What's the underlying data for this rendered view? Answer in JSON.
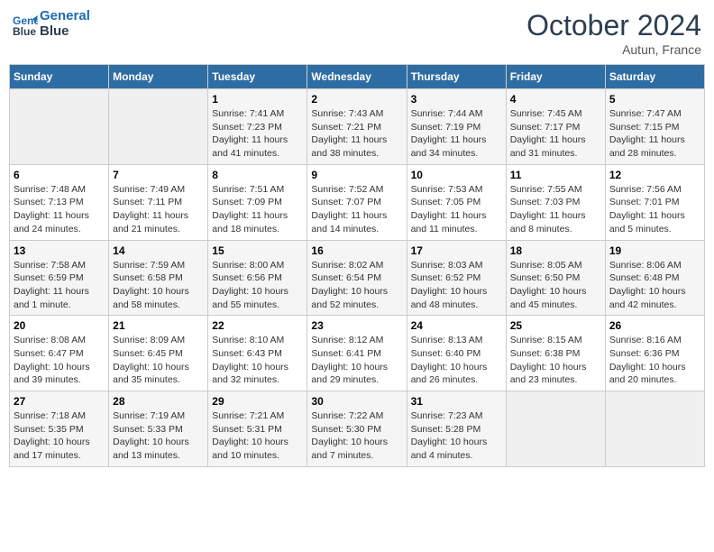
{
  "header": {
    "logo_line1": "General",
    "logo_line2": "Blue",
    "month": "October 2024",
    "location": "Autun, France"
  },
  "days_of_week": [
    "Sunday",
    "Monday",
    "Tuesday",
    "Wednesday",
    "Thursday",
    "Friday",
    "Saturday"
  ],
  "weeks": [
    [
      {
        "day": "",
        "sunrise": "",
        "sunset": "",
        "daylight": "",
        "empty": true
      },
      {
        "day": "",
        "sunrise": "",
        "sunset": "",
        "daylight": "",
        "empty": true
      },
      {
        "day": "1",
        "sunrise": "Sunrise: 7:41 AM",
        "sunset": "Sunset: 7:23 PM",
        "daylight": "Daylight: 11 hours and 41 minutes."
      },
      {
        "day": "2",
        "sunrise": "Sunrise: 7:43 AM",
        "sunset": "Sunset: 7:21 PM",
        "daylight": "Daylight: 11 hours and 38 minutes."
      },
      {
        "day": "3",
        "sunrise": "Sunrise: 7:44 AM",
        "sunset": "Sunset: 7:19 PM",
        "daylight": "Daylight: 11 hours and 34 minutes."
      },
      {
        "day": "4",
        "sunrise": "Sunrise: 7:45 AM",
        "sunset": "Sunset: 7:17 PM",
        "daylight": "Daylight: 11 hours and 31 minutes."
      },
      {
        "day": "5",
        "sunrise": "Sunrise: 7:47 AM",
        "sunset": "Sunset: 7:15 PM",
        "daylight": "Daylight: 11 hours and 28 minutes."
      }
    ],
    [
      {
        "day": "6",
        "sunrise": "Sunrise: 7:48 AM",
        "sunset": "Sunset: 7:13 PM",
        "daylight": "Daylight: 11 hours and 24 minutes."
      },
      {
        "day": "7",
        "sunrise": "Sunrise: 7:49 AM",
        "sunset": "Sunset: 7:11 PM",
        "daylight": "Daylight: 11 hours and 21 minutes."
      },
      {
        "day": "8",
        "sunrise": "Sunrise: 7:51 AM",
        "sunset": "Sunset: 7:09 PM",
        "daylight": "Daylight: 11 hours and 18 minutes."
      },
      {
        "day": "9",
        "sunrise": "Sunrise: 7:52 AM",
        "sunset": "Sunset: 7:07 PM",
        "daylight": "Daylight: 11 hours and 14 minutes."
      },
      {
        "day": "10",
        "sunrise": "Sunrise: 7:53 AM",
        "sunset": "Sunset: 7:05 PM",
        "daylight": "Daylight: 11 hours and 11 minutes."
      },
      {
        "day": "11",
        "sunrise": "Sunrise: 7:55 AM",
        "sunset": "Sunset: 7:03 PM",
        "daylight": "Daylight: 11 hours and 8 minutes."
      },
      {
        "day": "12",
        "sunrise": "Sunrise: 7:56 AM",
        "sunset": "Sunset: 7:01 PM",
        "daylight": "Daylight: 11 hours and 5 minutes."
      }
    ],
    [
      {
        "day": "13",
        "sunrise": "Sunrise: 7:58 AM",
        "sunset": "Sunset: 6:59 PM",
        "daylight": "Daylight: 11 hours and 1 minute."
      },
      {
        "day": "14",
        "sunrise": "Sunrise: 7:59 AM",
        "sunset": "Sunset: 6:58 PM",
        "daylight": "Daylight: 10 hours and 58 minutes."
      },
      {
        "day": "15",
        "sunrise": "Sunrise: 8:00 AM",
        "sunset": "Sunset: 6:56 PM",
        "daylight": "Daylight: 10 hours and 55 minutes."
      },
      {
        "day": "16",
        "sunrise": "Sunrise: 8:02 AM",
        "sunset": "Sunset: 6:54 PM",
        "daylight": "Daylight: 10 hours and 52 minutes."
      },
      {
        "day": "17",
        "sunrise": "Sunrise: 8:03 AM",
        "sunset": "Sunset: 6:52 PM",
        "daylight": "Daylight: 10 hours and 48 minutes."
      },
      {
        "day": "18",
        "sunrise": "Sunrise: 8:05 AM",
        "sunset": "Sunset: 6:50 PM",
        "daylight": "Daylight: 10 hours and 45 minutes."
      },
      {
        "day": "19",
        "sunrise": "Sunrise: 8:06 AM",
        "sunset": "Sunset: 6:48 PM",
        "daylight": "Daylight: 10 hours and 42 minutes."
      }
    ],
    [
      {
        "day": "20",
        "sunrise": "Sunrise: 8:08 AM",
        "sunset": "Sunset: 6:47 PM",
        "daylight": "Daylight: 10 hours and 39 minutes."
      },
      {
        "day": "21",
        "sunrise": "Sunrise: 8:09 AM",
        "sunset": "Sunset: 6:45 PM",
        "daylight": "Daylight: 10 hours and 35 minutes."
      },
      {
        "day": "22",
        "sunrise": "Sunrise: 8:10 AM",
        "sunset": "Sunset: 6:43 PM",
        "daylight": "Daylight: 10 hours and 32 minutes."
      },
      {
        "day": "23",
        "sunrise": "Sunrise: 8:12 AM",
        "sunset": "Sunset: 6:41 PM",
        "daylight": "Daylight: 10 hours and 29 minutes."
      },
      {
        "day": "24",
        "sunrise": "Sunrise: 8:13 AM",
        "sunset": "Sunset: 6:40 PM",
        "daylight": "Daylight: 10 hours and 26 minutes."
      },
      {
        "day": "25",
        "sunrise": "Sunrise: 8:15 AM",
        "sunset": "Sunset: 6:38 PM",
        "daylight": "Daylight: 10 hours and 23 minutes."
      },
      {
        "day": "26",
        "sunrise": "Sunrise: 8:16 AM",
        "sunset": "Sunset: 6:36 PM",
        "daylight": "Daylight: 10 hours and 20 minutes."
      }
    ],
    [
      {
        "day": "27",
        "sunrise": "Sunrise: 7:18 AM",
        "sunset": "Sunset: 5:35 PM",
        "daylight": "Daylight: 10 hours and 17 minutes."
      },
      {
        "day": "28",
        "sunrise": "Sunrise: 7:19 AM",
        "sunset": "Sunset: 5:33 PM",
        "daylight": "Daylight: 10 hours and 13 minutes."
      },
      {
        "day": "29",
        "sunrise": "Sunrise: 7:21 AM",
        "sunset": "Sunset: 5:31 PM",
        "daylight": "Daylight: 10 hours and 10 minutes."
      },
      {
        "day": "30",
        "sunrise": "Sunrise: 7:22 AM",
        "sunset": "Sunset: 5:30 PM",
        "daylight": "Daylight: 10 hours and 7 minutes."
      },
      {
        "day": "31",
        "sunrise": "Sunrise: 7:23 AM",
        "sunset": "Sunset: 5:28 PM",
        "daylight": "Daylight: 10 hours and 4 minutes."
      },
      {
        "day": "",
        "sunrise": "",
        "sunset": "",
        "daylight": "",
        "empty": true
      },
      {
        "day": "",
        "sunrise": "",
        "sunset": "",
        "daylight": "",
        "empty": true
      }
    ]
  ]
}
